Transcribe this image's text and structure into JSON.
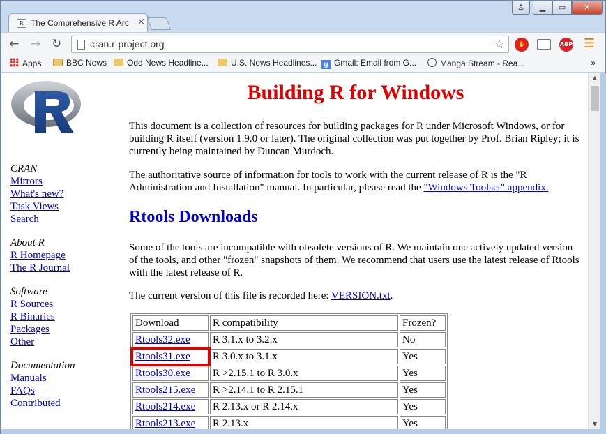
{
  "browser": {
    "tab_title": "The Comprehensive R Arc",
    "tab_close": "×",
    "url": "cran.r-project.org",
    "window_controls": {
      "minimize": "▁",
      "maximize": "▭",
      "close": "✕"
    }
  },
  "bookmarks": [
    {
      "label": "Apps",
      "icon": "apps-icon"
    },
    {
      "label": "BBC News",
      "icon": "folder-icon"
    },
    {
      "label": "Odd News Headline...",
      "icon": "folder-icon"
    },
    {
      "label": "U.S. News Headlines...",
      "icon": "folder-icon"
    },
    {
      "label": "Gmail: Email from G...",
      "icon": "google-icon"
    },
    {
      "label": "Manga Stream - Rea...",
      "icon": "manga-icon"
    }
  ],
  "bookmarks_more": "»",
  "sidebar": {
    "cran": {
      "heading": "CRAN",
      "links": [
        "Mirrors",
        "What's new?",
        "Task Views",
        "Search"
      ]
    },
    "about": {
      "heading": "About R",
      "links": [
        "R Homepage",
        "The R Journal"
      ]
    },
    "software": {
      "heading": "Software",
      "links": [
        "R Sources",
        "R Binaries",
        "Packages",
        "Other"
      ]
    },
    "documentation": {
      "heading": "Documentation",
      "links": [
        "Manuals",
        "FAQs",
        "Contributed"
      ]
    }
  },
  "main": {
    "title": "Building R for Windows",
    "intro": "This document is a collection of resources for building packages for R under Microsoft Windows, or for building R itself (version 1.9.0 or later). The original collection was put together by Prof. Brian Ripley; it is currently being maintained by Duncan Murdoch.",
    "authoritative_text": "The authoritative source of information for tools to work with the current release of R is the \"R Administration and Installation\" manual. In particular, please read the ",
    "toolset_link": "\"Windows Toolset\" appendix.",
    "rtools_heading": "Rtools Downloads",
    "rtools_text": "Some of the tools are incompatible with obsolete versions of R. We maintain one actively updated version of the tools, and other \"frozen\" snapshots of them. We recommend that users use the latest release of Rtools with the latest release of R.",
    "version_text": "The current version of this file is recorded here: ",
    "version_link": "VERSION.txt",
    "version_suffix": ".",
    "table": {
      "headers": [
        "Download",
        "R compatibility",
        "Frozen?"
      ],
      "rows": [
        [
          "Rtools32.exe",
          "R 3.1.x to 3.2.x",
          "No"
        ],
        [
          "Rtools31.exe",
          "R 3.0.x to 3.1.x",
          "Yes"
        ],
        [
          "Rtools30.exe",
          "R >2.15.1 to R 3.0.x",
          "Yes"
        ],
        [
          "Rtools215.exe",
          "R >2.14.1 to R 2.15.1",
          "Yes"
        ],
        [
          "Rtools214.exe",
          "R 2.13.x or R 2.14.x",
          "Yes"
        ],
        [
          "Rtools213.exe",
          "R 2.13.x",
          "Yes"
        ]
      ],
      "highlighted_row": 1
    }
  },
  "colors": {
    "title_red": "#e00000",
    "link_blue": "#0000cc",
    "highlight_red": "#e00000"
  }
}
